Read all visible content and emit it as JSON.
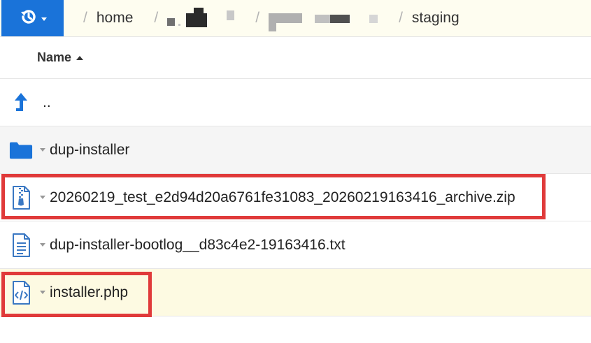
{
  "breadcrumb": {
    "items": [
      "home",
      "staging"
    ],
    "separator": "/"
  },
  "table": {
    "column_name_label": "Name",
    "sort": "ascending"
  },
  "rows": [
    {
      "name": "..",
      "type": "parent-directory",
      "icon": "arrow-up-icon"
    },
    {
      "name": "dup-installer",
      "type": "folder",
      "icon": "folder-icon"
    },
    {
      "name": "20260219_test_e2d94d20a6761fe31083_20260219163416_archive.zip",
      "type": "zip",
      "icon": "zip-file-icon"
    },
    {
      "name": "dup-installer-bootlog__d83c4e2-19163416.txt",
      "type": "text",
      "icon": "text-file-icon"
    },
    {
      "name": "installer.php",
      "type": "code",
      "icon": "code-file-icon"
    }
  ],
  "colors": {
    "accent": "#1a73d9",
    "highlight_box": "#e03a3a",
    "breadcrumb_bg": "#fefdf0",
    "selected_row_bg": "#fdfae2",
    "alt_row_bg": "#f5f5f5",
    "file_icon": "#3a78c3"
  }
}
